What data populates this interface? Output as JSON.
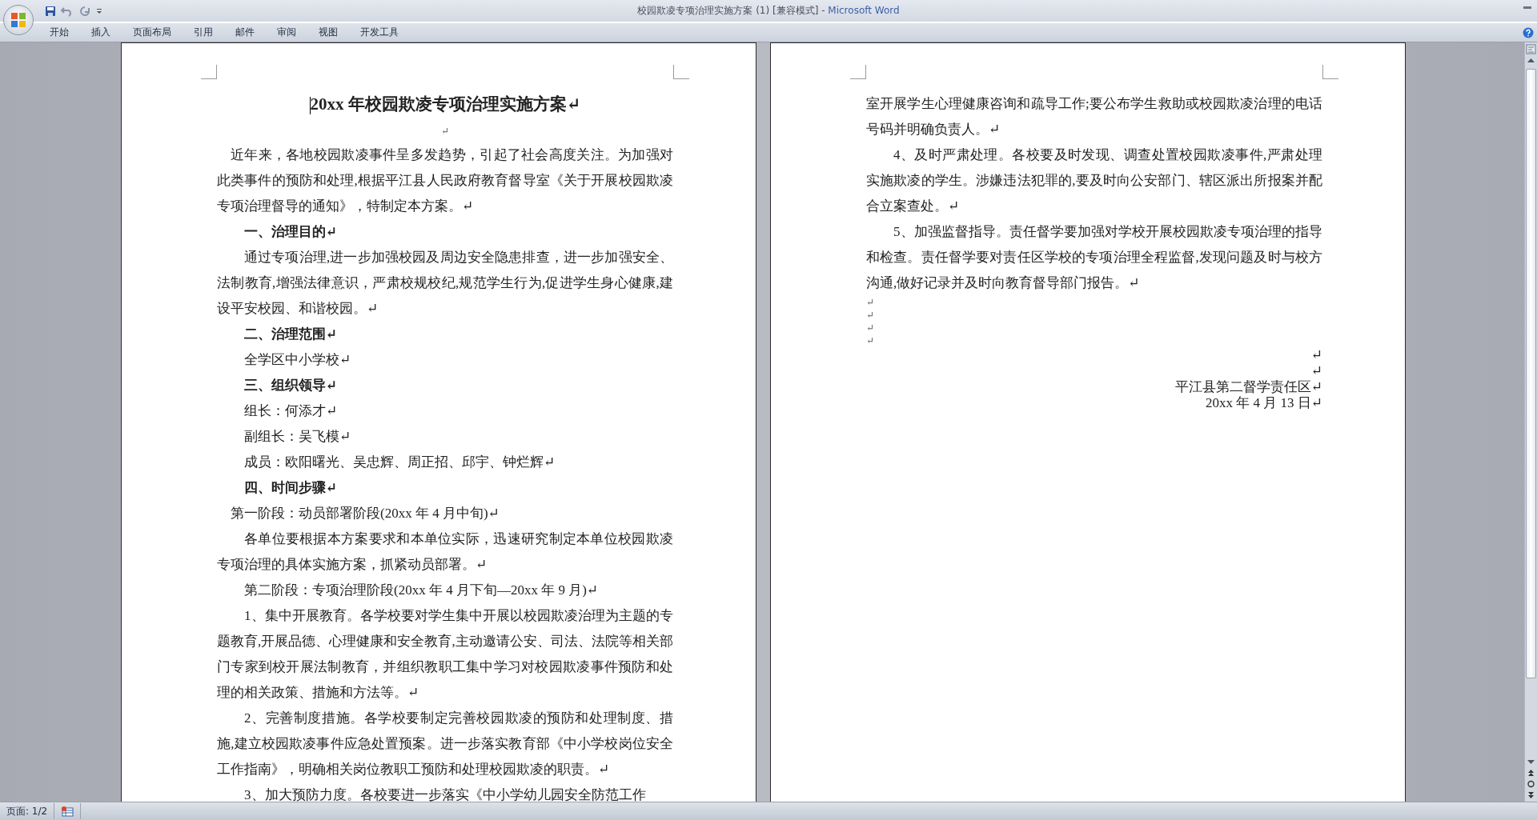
{
  "window": {
    "document_title": "校园欺凌专项治理实施方案 (1) [兼容模式] - ",
    "app_name": "Microsoft Word"
  },
  "ribbon_tabs": [
    "开始",
    "插入",
    "页面布局",
    "引用",
    "邮件",
    "审阅",
    "视图",
    "开发工具"
  ],
  "pages": [
    {
      "paragraphs": [
        {
          "kind": "title",
          "text": "20xx 年校园欺凌专项治理实施方案↵"
        },
        {
          "kind": "blank",
          "text": "↵"
        },
        {
          "kind": "lead",
          "text": "近年来，各地校园欺凌事件呈多发趋势，引起了社会高度关注。为加强对此类事件的预防和处理,根据平江县人民政府教育督导室《关于开展校园欺凌专项治理督导的通知》，特制定本方案。↵"
        },
        {
          "kind": "heading",
          "text": "一、治理目的↵"
        },
        {
          "kind": "body",
          "text": "通过专项治理,进一步加强校园及周边安全隐患排查，进一步加强安全、法制教育,增强法律意识，严肃校规校纪,规范学生行为,促进学生身心健康,建设平安校园、和谐校园。↵"
        },
        {
          "kind": "heading",
          "text": "二、治理范围↵"
        },
        {
          "kind": "body",
          "text": "全学区中小学校↵"
        },
        {
          "kind": "heading",
          "text": "三、组织领导↵"
        },
        {
          "kind": "body",
          "text": "组长：何添才↵"
        },
        {
          "kind": "body",
          "text": "副组长：吴飞模↵"
        },
        {
          "kind": "body",
          "text": "成员：欧阳曙光、吴忠辉、周正招、邱宇、钟烂辉↵"
        },
        {
          "kind": "heading",
          "text": "四、时间步骤↵"
        },
        {
          "kind": "lead",
          "text": "第一阶段：动员部署阶段(20xx 年 4 月中旬)↵"
        },
        {
          "kind": "body",
          "text": "各单位要根据本方案要求和本单位实际，迅速研究制定本单位校园欺凌专项治理的具体实施方案，抓紧动员部署。↵"
        },
        {
          "kind": "body",
          "text": "第二阶段：专项治理阶段(20xx 年 4 月下旬—20xx 年 9 月)↵"
        },
        {
          "kind": "body",
          "text": "1、集中开展教育。各学校要对学生集中开展以校园欺凌治理为主题的专题教育,开展品德、心理健康和安全教育,主动邀请公安、司法、法院等相关部门专家到校开展法制教育，并组织教职工集中学习对校园欺凌事件预防和处理的相关政策、措施和方法等。↵"
        },
        {
          "kind": "body",
          "text": "2、完善制度措施。各学校要制定完善校园欺凌的预防和处理制度、措施,建立校园欺凌事件应急处置预案。进一步落实教育部《中小学校岗位安全工作指南》，明确相关岗位教职工预防和处理校园欺凌的职责。↵"
        },
        {
          "kind": "body",
          "text": "3、加大预防力度。各校要进一步落实《中小学幼儿园安全防范工作"
        }
      ]
    },
    {
      "paragraphs": [
        {
          "kind": "flush",
          "text": "室开展学生心理健康咨询和疏导工作;要公布学生救助或校园欺凌治理的电话号码并明确负责人。↵"
        },
        {
          "kind": "body",
          "text": "4、及时严肃处理。各校要及时发现、调查处置校园欺凌事件,严肃处理实施欺凌的学生。涉嫌违法犯罪的,要及时向公安部门、辖区派出所报案并配合立案查处。↵"
        },
        {
          "kind": "body",
          "text": "5、加强监督指导。责任督学要加强对学校开展校园欺凌专项治理的指导和检查。责任督学要对责任区学校的专项治理全程监督,发现问题及时与校方沟通,做好记录并及时向教育督导部门报告。↵"
        },
        {
          "kind": "empty",
          "text": "↵"
        },
        {
          "kind": "empty",
          "text": "↵"
        },
        {
          "kind": "empty",
          "text": "↵"
        },
        {
          "kind": "empty",
          "text": "↵"
        },
        {
          "kind": "right",
          "text": "↵"
        },
        {
          "kind": "right",
          "text": "↵"
        },
        {
          "kind": "right",
          "text": "平江县第二督学责任区↵"
        },
        {
          "kind": "right",
          "text": "20xx 年 4 月 13 日↵"
        }
      ]
    }
  ],
  "status_bar": {
    "page": "页面: 1/2"
  }
}
